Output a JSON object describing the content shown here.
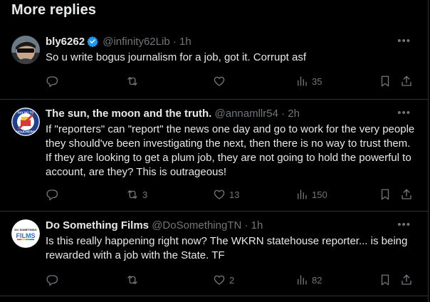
{
  "section_title": "More replies",
  "colors": {
    "background": "#000000",
    "text": "#e7e9ea",
    "muted": "#71767b",
    "verified": "#1d9bf0",
    "divider": "#2f3336"
  },
  "tweets": [
    {
      "display_name": "bly6262",
      "verified": true,
      "handle": "@infinity62Lib",
      "separator": "·",
      "time": "1h",
      "text": "So u write bogus journalism for a job, got it. Corrupt asf",
      "replies": "",
      "retweets": "",
      "likes": "",
      "views": "35",
      "avatar": "person-with-sunglasses"
    },
    {
      "display_name": "The sun, the moon and the truth.",
      "verified": false,
      "handle": "@annamllr54",
      "separator": "·",
      "time": "2h",
      "text": "If \"reporters\" can \"report\" the news one day and go to work for the very people they should've been investigating the next, then there is no way to trust them. If they are looking to get a plum job, they are not going to hold the powerful to account, are they? This is outrageous!",
      "replies": "",
      "retweets": "3",
      "likes": "13",
      "views": "150",
      "avatar": "say-no-to-vouchers-badge",
      "avatar_text_top": "SAY NO TO",
      "avatar_text_bottom": "VOUCHERS"
    },
    {
      "display_name": "Do Something Films",
      "verified": false,
      "handle": "@DoSomethingTN",
      "separator": "·",
      "time": "1h",
      "text": "Is this really happening right now? The WKRN statehouse reporter... is being rewarded with a job with the State. TF",
      "replies": "",
      "retweets": "",
      "likes": "2",
      "views": "82",
      "avatar": "do-something-films-logo",
      "avatar_text_top": "DO SOMETHING",
      "avatar_text_bottom": "FILMS"
    }
  ],
  "icons": {
    "more": "more-horizontal-icon",
    "reply": "reply-icon",
    "retweet": "retweet-icon",
    "like": "heart-icon",
    "views": "views-bar-chart-icon",
    "bookmark": "bookmark-icon",
    "share": "share-upload-icon",
    "verified": "verified-badge-icon"
  }
}
